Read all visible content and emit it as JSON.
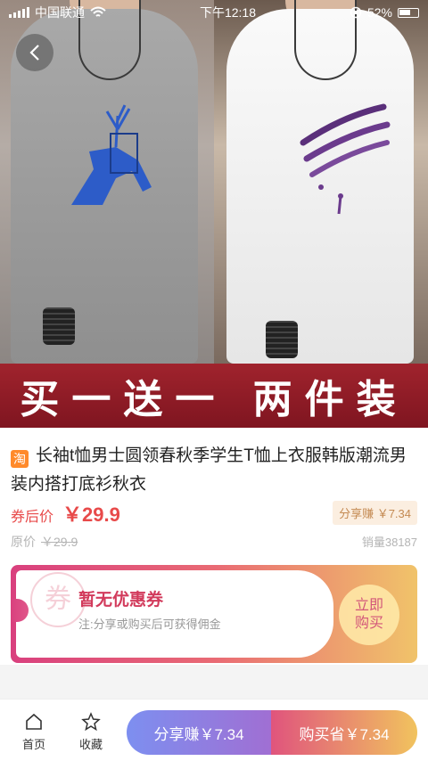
{
  "status_bar": {
    "carrier": "中国联通",
    "time": "下午12:18",
    "battery": "52%"
  },
  "hero": {
    "banner": "买一送一 两件装"
  },
  "product": {
    "platform_icon": "淘",
    "title": "长袖t恤男士圆领春秋季学生T恤上衣服韩版潮流男装内搭打底衫秋衣",
    "coupon_price_label": "券后价",
    "coupon_price": "￥29.9",
    "share_earn_tag": "分享赚 ￥7.34",
    "original_label": "原价",
    "original_price": "￥29.9",
    "sales": "销量38187"
  },
  "coupon": {
    "watermark": "券",
    "title": "暂无优惠券",
    "subtitle": "注:分享或购买后可获得佣金",
    "buy_now_line1": "立即",
    "buy_now_line2": "购买"
  },
  "bottom_bar": {
    "home_label": "首页",
    "favorite_label": "收藏",
    "share_button": "分享赚￥7.34",
    "buy_button": "购买省￥7.34"
  },
  "colors": {
    "accent_red": "#e84a4a",
    "banner_red": "#a0232d",
    "coupon_pink": "#d23b5c"
  }
}
